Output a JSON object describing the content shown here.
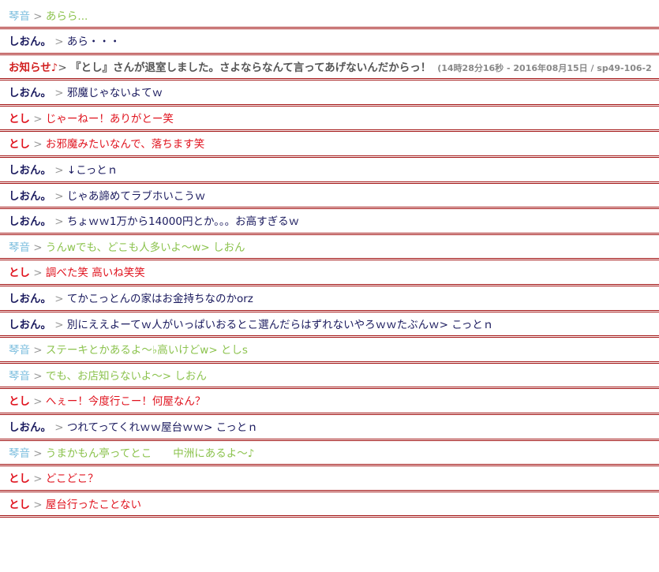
{
  "colors": {
    "kotone": "#7cbede",
    "kotone_text": "#8cc34e",
    "shion": "#1a1a5e",
    "toshi": "#e0131e",
    "notice": "#d11f1f",
    "notice_text": "#555555",
    "separator": "#999999",
    "divider": "#a21313"
  },
  "messages": [
    {
      "speaker": "琴音",
      "role": "kotone",
      "sep": " > ",
      "text": "あらら..."
    },
    {
      "speaker": "しおん。",
      "role": "shion",
      "sep": " > ",
      "text": "あら・・・"
    },
    {
      "speaker": "お知らせ♪",
      "role": "notice",
      "sep": "> ",
      "text": "『とし』さんが退室しました。さよならなんて言ってあげないんだからっ！",
      "meta": "(14時28分16秒 - 2016年08月15日 / sp49-106-2"
    },
    {
      "speaker": "しおん。",
      "role": "shion",
      "sep": " > ",
      "text": "邪魔じゃないよてｗ"
    },
    {
      "speaker": "とし",
      "role": "toshi",
      "sep": " > ",
      "text": "じゃーねー！ありがとー笑"
    },
    {
      "speaker": "とし",
      "role": "toshi",
      "sep": " > ",
      "text": "お邪魔みたいなんで、落ちます笑"
    },
    {
      "speaker": "しおん。",
      "role": "shion",
      "sep": " > ",
      "text": "↓こっとｎ"
    },
    {
      "speaker": "しおん。",
      "role": "shion",
      "sep": " > ",
      "text": "じゃあ諦めてラブホいこうｗ"
    },
    {
      "speaker": "しおん。",
      "role": "shion",
      "sep": " > ",
      "text": "ちょｗｗ1万から14000円とか。。。お高すぎるｗ"
    },
    {
      "speaker": "琴音",
      "role": "kotone",
      "sep": " > ",
      "text": "うんwでも、どこも人多いよ〜w> しおん"
    },
    {
      "speaker": "とし",
      "role": "toshi",
      "sep": " > ",
      "text": "調べた笑 高いね笑笑"
    },
    {
      "speaker": "しおん。",
      "role": "shion",
      "sep": " > ",
      "text": "てかこっとんの家はお金持ちなのかorz"
    },
    {
      "speaker": "しおん。",
      "role": "shion",
      "sep": " > ",
      "text": "別にええよーてｗ人がいっぱいおるとこ選んだらはずれないやろｗｗたぶんｗ> こっとｎ"
    },
    {
      "speaker": "琴音",
      "role": "kotone",
      "sep": " > ",
      "text": "ステーキとかあるよ〜♭高いけどw> としs"
    },
    {
      "speaker": "琴音",
      "role": "kotone",
      "sep": " > ",
      "text": "でも、お店知らないよ〜> しおん"
    },
    {
      "speaker": "とし",
      "role": "toshi",
      "sep": " > ",
      "text": "へぇー！今度行こー！何屋なん？"
    },
    {
      "speaker": "しおん。",
      "role": "shion",
      "sep": " > ",
      "text": "つれてってくれｗｗ屋台ｗｗ> こっとｎ"
    },
    {
      "speaker": "琴音",
      "role": "kotone",
      "sep": " > ",
      "text": "うまかもん亭ってとこ　　中洲にあるよ〜♪"
    },
    {
      "speaker": "とし",
      "role": "toshi",
      "sep": " > ",
      "text": "どこどこ？"
    },
    {
      "speaker": "とし",
      "role": "toshi",
      "sep": " > ",
      "text": "屋台行ったことない"
    }
  ]
}
